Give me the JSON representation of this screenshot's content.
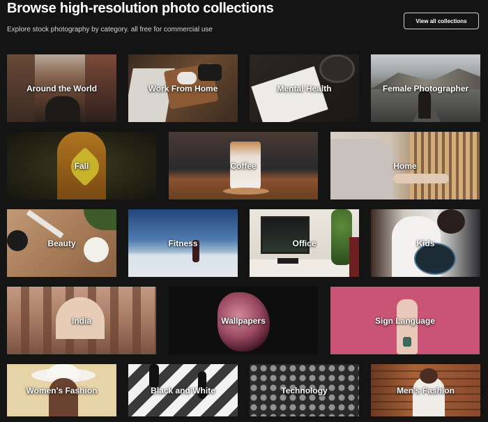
{
  "header": {
    "title": "Browse high-resolution photo collections",
    "subtitle": "Explore stock photography by category. all free for commercial use",
    "view_all_label": "View all collections"
  },
  "collections": [
    {
      "label": "Around the World"
    },
    {
      "label": "Work From Home"
    },
    {
      "label": "Mental Health"
    },
    {
      "label": "Female Photographer"
    },
    {
      "label": "Fall"
    },
    {
      "label": "Coffee"
    },
    {
      "label": "Home"
    },
    {
      "label": "Beauty"
    },
    {
      "label": "Fitness"
    },
    {
      "label": "Office"
    },
    {
      "label": "Kids"
    },
    {
      "label": "India"
    },
    {
      "label": "Wallpapers"
    },
    {
      "label": "Sign Language"
    },
    {
      "label": "Women's Fashion"
    },
    {
      "label": "Black and White"
    },
    {
      "label": "Technology"
    },
    {
      "label": "Men's Fashion"
    }
  ],
  "colors": {
    "background": "#141414",
    "sign_language_pink": "#c95476"
  }
}
